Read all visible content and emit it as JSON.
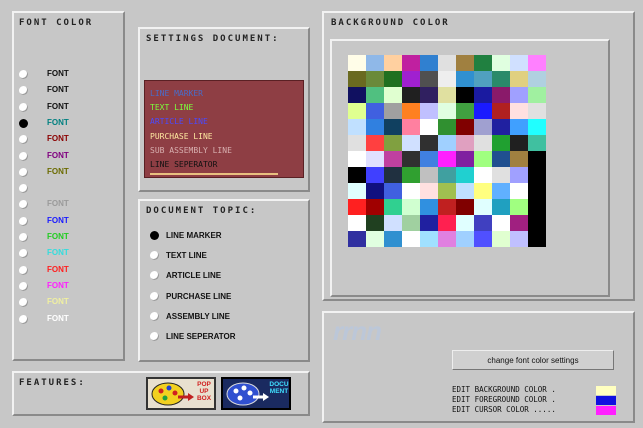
{
  "font_color": {
    "title": "FONT COLOR",
    "options": [
      {
        "label": "FONT",
        "color": "#111111",
        "selected": false
      },
      {
        "label": "FONT",
        "color": "#111111",
        "selected": false
      },
      {
        "label": "FONT",
        "color": "#111111",
        "selected": false
      },
      {
        "label": "FONT",
        "color": "#008080",
        "selected": true
      },
      {
        "label": "FONT",
        "color": "#8b0000",
        "selected": false
      },
      {
        "label": "FONT",
        "color": "#800080",
        "selected": false
      },
      {
        "label": "FONT",
        "color": "#6b6b00",
        "selected": false
      },
      {
        "label": "",
        "color": "#111111",
        "selected": false
      },
      {
        "label": "FONT",
        "color": "#9a9a9a",
        "selected": false
      },
      {
        "label": "FONT",
        "color": "#1a1aff",
        "selected": false
      },
      {
        "label": "FONT",
        "color": "#22cc22",
        "selected": false
      },
      {
        "label": "FONT",
        "color": "#33dddd",
        "selected": false
      },
      {
        "label": "FONT",
        "color": "#ff2020",
        "selected": false
      },
      {
        "label": "FONT",
        "color": "#ff20ff",
        "selected": false
      },
      {
        "label": "FONT",
        "color": "#f0f0a0",
        "selected": false
      },
      {
        "label": "FONT",
        "color": "#ffffff",
        "selected": false
      }
    ]
  },
  "settings_document": {
    "title": "SETTINGS DOCUMENT:",
    "lines": [
      {
        "text": "LINE MARKER",
        "color": "#4a6cc8"
      },
      {
        "text": "TEXT LINE",
        "color": "#7cff3c"
      },
      {
        "text": "ARTICLE LINE",
        "color": "#4a4aff"
      },
      {
        "text": "PURCHASE LINE",
        "color": "#ffe9a0"
      },
      {
        "text": "SUB ASSEMBLY LINE",
        "color": "#d8b0b0"
      },
      {
        "text": "LINE SEPERATOR",
        "color": "#111111"
      }
    ]
  },
  "document_topic": {
    "title": "DOCUMENT TOPIC:",
    "options": [
      {
        "label": "LINE MARKER",
        "selected": true
      },
      {
        "label": "TEXT LINE",
        "selected": false
      },
      {
        "label": "ARTICLE LINE",
        "selected": false
      },
      {
        "label": "PURCHASE LINE",
        "selected": false
      },
      {
        "label": "ASSEMBLY LINE",
        "selected": false
      },
      {
        "label": "LINE SEPERATOR",
        "selected": false
      }
    ]
  },
  "features": {
    "title": "FEATURES:",
    "popup_label": "POP UP BOX",
    "document_label": "DOCU MENT"
  },
  "background_color": {
    "title": "BACKGROUND COLOR",
    "palette": [
      "#fffde8",
      "#8fb8e8",
      "#ffd0a0",
      "#c020a0",
      "#3080d0",
      "#e0e0e0",
      "#a08040",
      "#208040",
      "#e0ffe0",
      "#d0e0ff",
      "#ff80ff",
      "#6a6a20",
      "#6a8a3a",
      "#207020",
      "#a020d0",
      "#505050",
      "#eeeeee",
      "#3090d0",
      "#50a0c0",
      "#2a8a6a",
      "#e0d080",
      "#b0d0e0",
      "#101060",
      "#50c080",
      "#e0ffd0",
      "#202020",
      "#302060",
      "#e0e0a0",
      "#000000",
      "#1a1aa0",
      "#8a1a6a",
      "#a0a0ff",
      "#a0f0a0",
      "#e0ff90",
      "#4060e0",
      "#a0a0a0",
      "#ff8020",
      "#c0c0ff",
      "#e0ffe0",
      "#40a040",
      "#1a1aff",
      "#b02020",
      "#ffe0e0",
      "#e0e0e0",
      "#c0e0ff",
      "#3080e0",
      "#104060",
      "#ff80a0",
      "#ffffff",
      "#309030",
      "#800000",
      "#a0a0d0",
      "#2020a0",
      "#40a0ff",
      "#20ffff",
      "#e0e0e0",
      "#ff4040",
      "#80a040",
      "#d0e0ff",
      "#303030",
      "#a0d0ff",
      "#e0a0c0",
      "#e0e0e0",
      "#20a030",
      "#202020",
      "#40c0a0",
      "#ffffff",
      "#e0e0ff",
      "#c040a0",
      "#303030",
      "#4080e0",
      "#ff20ff",
      "#8020a0",
      "#a0ff80",
      "#205090",
      "#a08040",
      "#000000",
      "#000000",
      "#4040ff",
      "#203040",
      "#30a030",
      "#c0c0c0",
      "#40a0a0",
      "#20d0d0",
      "#ffffff",
      "#e0e0e0",
      "#a0a0ff",
      "#000000",
      "#e0ffff",
      "#101080",
      "#4060e0",
      "#ffffff",
      "#ffe0e0",
      "#a0c050",
      "#c0e0ff",
      "#ffff80",
      "#60b0ff",
      "#ffffff",
      "#000000",
      "#ff2020",
      "#a00000",
      "#30d090",
      "#d0ffd0",
      "#3090e0",
      "#c02020",
      "#800000",
      "#e0ffff",
      "#20a0c0",
      "#a0ff80",
      "#000000",
      "#ffffff",
      "#204020",
      "#d0e0ff",
      "#a0d0a0",
      "#2020a0",
      "#ff2050",
      "#e0ffff",
      "#4040c0",
      "#ffffff",
      "#a02080",
      "#000000",
      "#3030a0",
      "#e0ffe0",
      "#3090d0",
      "#ffffff",
      "#a0e0ff",
      "#e080e0",
      "#a0d0ff",
      "#5050ff",
      "#e0ffd0",
      "#c0c0ff",
      "#000000"
    ]
  },
  "editor": {
    "watermark": "rrnn",
    "change_button": "change font color settings",
    "edit_lines": [
      {
        "label": "EDIT BACKGROUND COLOR .",
        "color": "#ffffc0"
      },
      {
        "label": "EDIT FOREGROUND COLOR .",
        "color": "#1010e0"
      },
      {
        "label": "EDIT CURSOR COLOR .....",
        "color": "#ff20ff"
      }
    ]
  }
}
